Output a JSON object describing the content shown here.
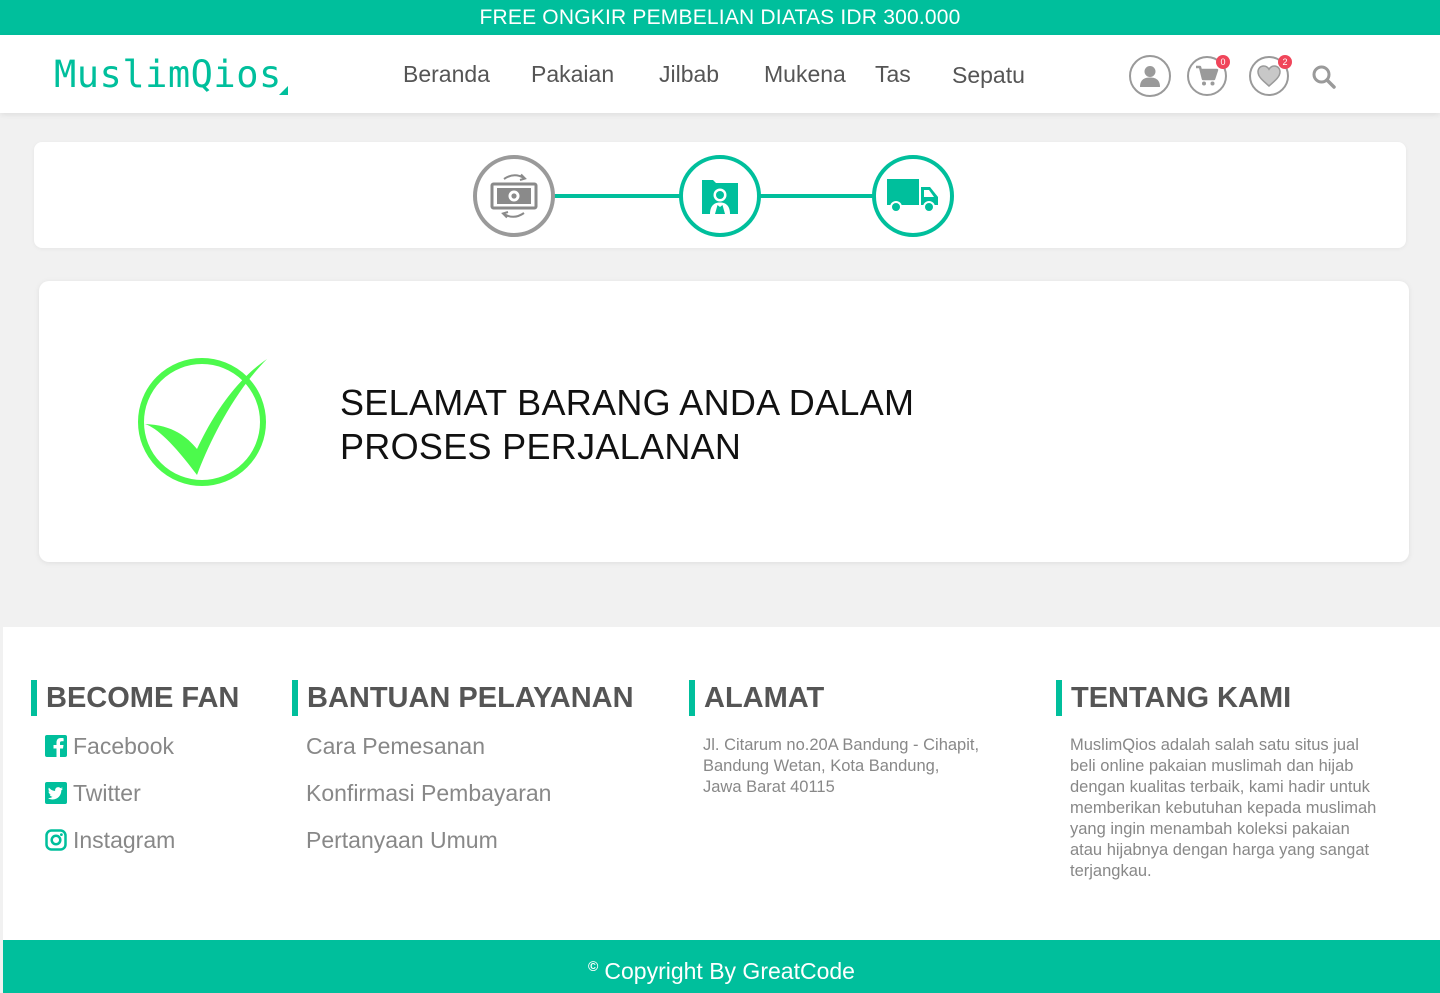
{
  "promo": {
    "text": "FREE ONGKIR PEMBELIAN DIATAS IDR 300.000"
  },
  "brand": {
    "name": "MuslimQios",
    "accent": "#00bf9c"
  },
  "nav": {
    "items": [
      {
        "label": "Beranda"
      },
      {
        "label": "Pakaian"
      },
      {
        "label": "Jilbab"
      },
      {
        "label": "Mukena"
      },
      {
        "label": "Tas"
      },
      {
        "label": "Sepatu"
      }
    ],
    "icons": {
      "user": "user-icon",
      "cart": "cart-icon",
      "cart_count": "0",
      "wishlist": "heart-icon",
      "wishlist_count": "2",
      "search": "search-icon"
    }
  },
  "progress": {
    "steps": [
      {
        "icon": "money-exchange-icon",
        "status": "inactive"
      },
      {
        "icon": "document-person-icon",
        "status": "active"
      },
      {
        "icon": "truck-icon",
        "status": "active"
      }
    ]
  },
  "success": {
    "icon": "check-circle-icon",
    "line1": "SELAMAT BARANG ANDA DALAM",
    "line2": "PROSES PERJALANAN",
    "icon_color": "#4cfa4c"
  },
  "footer": {
    "fan": {
      "heading": "BECOME FAN",
      "links": [
        {
          "label": "Facebook",
          "icon": "facebook-icon"
        },
        {
          "label": "Twitter",
          "icon": "twitter-icon"
        },
        {
          "label": "Instagram",
          "icon": "instagram-icon"
        }
      ]
    },
    "help": {
      "heading": "BANTUAN PELAYANAN",
      "links": [
        {
          "label": "Cara Pemesanan"
        },
        {
          "label": "Konfirmasi Pembayaran"
        },
        {
          "label": "Pertanyaan Umum"
        }
      ]
    },
    "address": {
      "heading": "ALAMAT",
      "lines": [
        "Jl. Citarum no.20A Bandung - Cihapit,",
        "Bandung Wetan, Kota Bandung,",
        "Jawa Barat 40115"
      ]
    },
    "about": {
      "heading": "TENTANG KAMI",
      "lines": [
        "MuslimQios adalah salah satu situs jual",
        "beli online pakaian muslimah dan hijab",
        "dengan kualitas terbaik, kami hadir untuk",
        "memberikan kebutuhan kepada muslimah",
        "yang ingin menambah koleksi pakaian",
        "atau hijabnya dengan harga yang sangat",
        "terjangkau."
      ]
    }
  },
  "copyright": {
    "symbol": "©",
    "text": "Copyright By GreatCode"
  }
}
